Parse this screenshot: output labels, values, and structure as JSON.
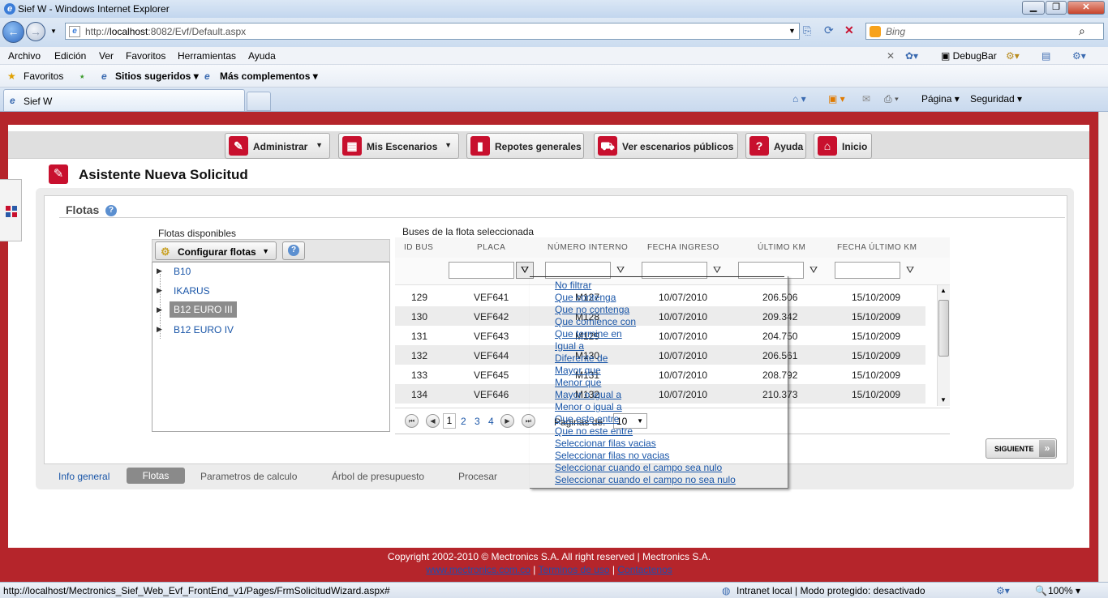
{
  "window": {
    "title": "Sief W - Windows Internet Explorer"
  },
  "address": {
    "prefix": "http://",
    "host": "localhost",
    "rest": ":8082/Evf/Default.aspx"
  },
  "search": {
    "placeholder": "Bing"
  },
  "menubar": [
    "Archivo",
    "Edición",
    "Ver",
    "Favoritos",
    "Herramientas",
    "Ayuda"
  ],
  "menubar_right": {
    "debugbar": "DebugBar"
  },
  "favbar": {
    "favoritos": "Favoritos",
    "sitios": "Sitios sugeridos",
    "complementos": "Más complementos"
  },
  "tab": {
    "label": "Sief W"
  },
  "commandbar": {
    "pagina": "Página",
    "seguridad": "Seguridad"
  },
  "nav": {
    "administrar": "Administrar",
    "escenarios": "Mis Escenarios",
    "reportes": "Repotes generales",
    "publicos": "Ver escenarios públicos",
    "ayuda": "Ayuda",
    "inicio": "Inicio"
  },
  "wizard": {
    "title": "Asistente Nueva Solicitud"
  },
  "flotas": {
    "header": "Flotas",
    "disponibles_label": "Flotas disponibles",
    "config_button": "Configurar flotas",
    "tree": [
      "B10",
      "IKARUS",
      "B12 EURO III",
      "B12 EURO IV"
    ],
    "selected_index": 2
  },
  "buses": {
    "label": "Buses de la flota seleccionada",
    "columns": [
      "ID BUS",
      "PLACA",
      "NÚMERO INTERNO",
      "FECHA INGRESO",
      "ÚLTIMO KM",
      "FECHA ÚLTIMO KM"
    ],
    "rows": [
      [
        "129",
        "VEF641",
        "M127",
        "10/07/2010",
        "206.506",
        "15/10/2009"
      ],
      [
        "130",
        "VEF642",
        "M128",
        "10/07/2010",
        "209.342",
        "15/10/2009"
      ],
      [
        "131",
        "VEF643",
        "M129",
        "10/07/2010",
        "204.750",
        "15/10/2009"
      ],
      [
        "132",
        "VEF644",
        "M130",
        "10/07/2010",
        "206.561",
        "15/10/2009"
      ],
      [
        "133",
        "VEF645",
        "M131",
        "10/07/2010",
        "208.792",
        "15/10/2009"
      ],
      [
        "134",
        "VEF646",
        "M132",
        "10/07/2010",
        "210.373",
        "15/10/2009"
      ]
    ],
    "pager": {
      "current": "1",
      "pages": [
        "2",
        "3",
        "4"
      ],
      "size_label": "Paginas de:",
      "size_value": "10"
    }
  },
  "filter_menu": [
    "No filtrar",
    "Que contenga",
    "Que no contenga",
    "Que comience con",
    "Que termine en",
    "Igual a",
    "Diferente de",
    "Mayor que",
    "Menor que",
    "Mayor o igual a",
    "Menor o igual a",
    "Que este entre",
    "Que no este entre",
    "Seleccionar filas vacias",
    "Seleccionar filas no vacias",
    "Seleccionar cuando el campo sea nulo",
    "Seleccionar cuando el campo no sea nulo"
  ],
  "next_button": "SIGUIENTE",
  "wizard_tabs": [
    "Info general",
    "Flotas",
    "Parametros de calculo",
    "Árbol de presupuesto",
    "Procesar"
  ],
  "footer": {
    "copyright": "Copyright 2002-2010 © Mectronics S.A. All right reserved | Mectronics S.A.",
    "site": "www.mectronics.com.co",
    "sep": "|",
    "terms": "Terminos de uso",
    "contact": "Contactenos"
  },
  "status": {
    "url": "http://localhost/Mectronics_Sief_Web_Evf_FrontEnd_v1/Pages/FrmSolicitudWizard.aspx#",
    "zone": "Intranet local | Modo protegido: desactivado",
    "zoom": "100%"
  }
}
